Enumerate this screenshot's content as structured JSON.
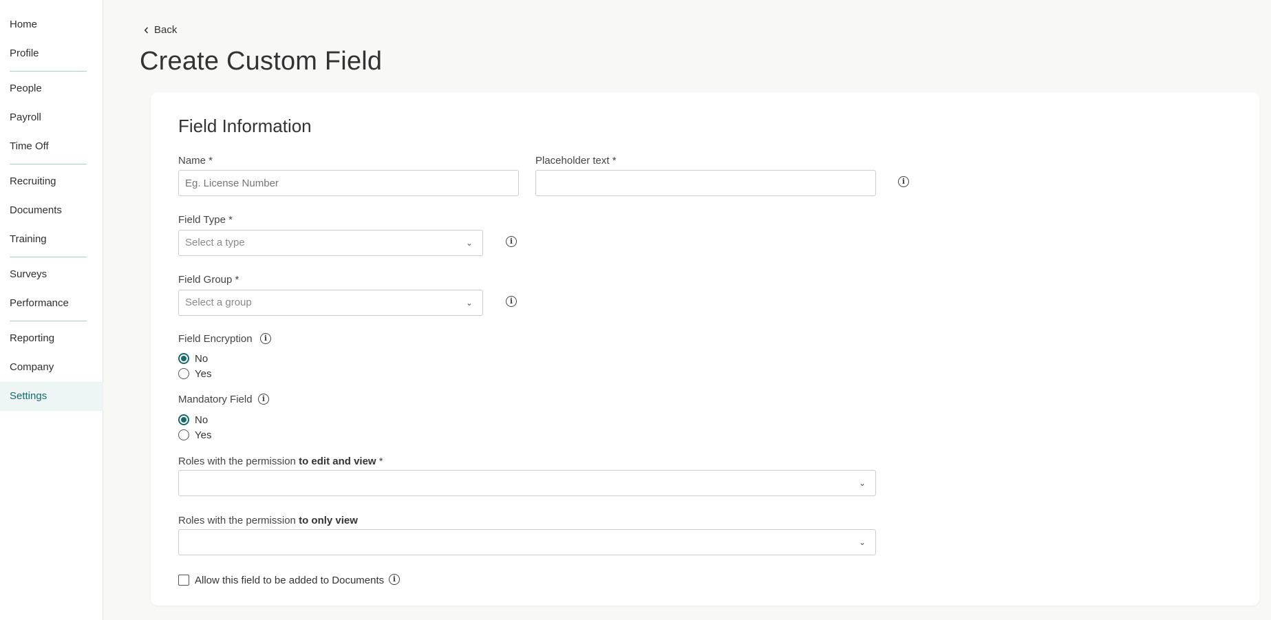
{
  "sidebar": {
    "items": [
      {
        "label": "Home"
      },
      {
        "label": "Profile"
      },
      {
        "label": "People"
      },
      {
        "label": "Payroll"
      },
      {
        "label": "Time Off"
      },
      {
        "label": "Recruiting"
      },
      {
        "label": "Documents"
      },
      {
        "label": "Training"
      },
      {
        "label": "Surveys"
      },
      {
        "label": "Performance"
      },
      {
        "label": "Reporting"
      },
      {
        "label": "Company"
      },
      {
        "label": "Settings"
      }
    ],
    "active": "Settings"
  },
  "header": {
    "back_label": "Back",
    "title": "Create Custom Field"
  },
  "form": {
    "section_title": "Field Information",
    "name": {
      "label": "Name *",
      "value": "",
      "placeholder": "Eg. License Number"
    },
    "placeholder_text": {
      "label": "Placeholder text *",
      "value": ""
    },
    "field_type": {
      "label": "Field Type *",
      "placeholder": "Select a type"
    },
    "field_group": {
      "label": "Field Group *",
      "placeholder": "Select a group"
    },
    "encryption": {
      "label": "Field Encryption",
      "options": [
        "No",
        "Yes"
      ],
      "selected": "No"
    },
    "mandatory": {
      "label": "Mandatory Field",
      "options": [
        "No",
        "Yes"
      ],
      "selected": "No"
    },
    "roles_edit": {
      "label_prefix": "Roles with the permission ",
      "label_bold": "to edit and view",
      "label_suffix": " *",
      "value": ""
    },
    "roles_view": {
      "label_prefix": "Roles with the permission ",
      "label_bold": "to only view",
      "value": ""
    },
    "documents": {
      "label": "Allow this field to be added to Documents",
      "checked": false
    }
  },
  "colors": {
    "accent": "#156b6b",
    "background": "#f8f8f7",
    "card": "#ffffff"
  }
}
